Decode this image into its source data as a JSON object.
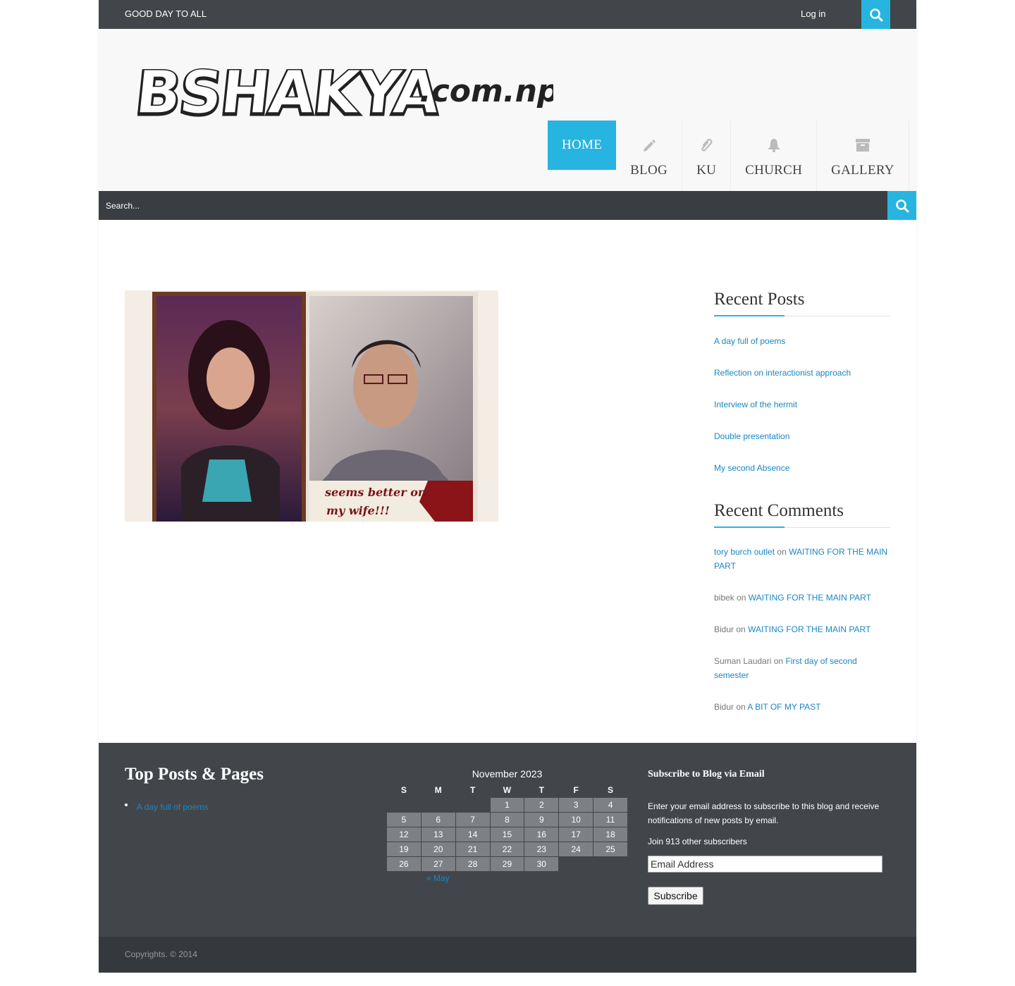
{
  "colors": {
    "accent": "#27b4e0",
    "dark_bar": "#42464b",
    "link": "#1a86c7"
  },
  "topbar": {
    "tagline": "GOOD DAY TO ALL",
    "login_label": "Log in",
    "search_icon": "search-icon"
  },
  "header": {
    "logo_text": "BSHAKYA",
    "logo_suffix": ".com.np",
    "nav": [
      {
        "label": "HOME",
        "icon": ""
      },
      {
        "label": "BLOG",
        "icon": "pencil-icon"
      },
      {
        "label": "KU",
        "icon": "paperclip-icon"
      },
      {
        "label": "CHURCH",
        "icon": "bell-icon"
      },
      {
        "label": "GALLERY",
        "icon": "archive-icon"
      }
    ]
  },
  "search": {
    "placeholder": "Search..."
  },
  "post": {
    "image_caption": [
      "seems better on",
      "my wife!!!"
    ]
  },
  "sidebar": {
    "recent_posts_title": "Recent Posts",
    "recent_posts": [
      "A day full of poems",
      "Reflection on interactionist approach",
      "Interview of the hermit",
      "Double presentation",
      "My second Absence"
    ],
    "recent_comments_title": "Recent Comments",
    "comments": [
      {
        "author": "tory burch outlet",
        "on": "on",
        "post": "WAITING FOR THE MAIN PART"
      },
      {
        "author": "bibek",
        "on": "on",
        "post": "WAITING FOR THE MAIN PART"
      },
      {
        "author": "Bidur",
        "on": "on",
        "post": "WAITING FOR THE MAIN PART"
      },
      {
        "author": "Suman Laudari",
        "on": "on",
        "post": "First day of second semester"
      },
      {
        "author": "Bidur",
        "on": "on",
        "post": "A BIT OF MY PAST"
      }
    ]
  },
  "footer": {
    "top_posts_title": "Top Posts & Pages",
    "top_posts": [
      "A day full of poems"
    ],
    "calendar": {
      "caption": "November 2023",
      "weekdays": [
        "S",
        "M",
        "T",
        "W",
        "T",
        "F",
        "S"
      ],
      "weeks": [
        [
          "",
          "",
          "",
          "1",
          "2",
          "3",
          "4"
        ],
        [
          "5",
          "6",
          "7",
          "8",
          "9",
          "10",
          "11"
        ],
        [
          "12",
          "13",
          "14",
          "15",
          "16",
          "17",
          "18"
        ],
        [
          "19",
          "20",
          "21",
          "22",
          "23",
          "24",
          "25"
        ],
        [
          "26",
          "27",
          "28",
          "29",
          "30",
          "",
          ""
        ]
      ],
      "prev_label": "« May"
    },
    "subscribe": {
      "title": "Subscribe to Blog via Email",
      "description": "Enter your email address to subscribe to this blog and receive notifications of new posts by email.",
      "subscribers": "Join 913 other subscribers",
      "email_placeholder": "Email Address",
      "button_label": "Subscribe"
    },
    "copyright": "Copyrights. © 2014"
  }
}
